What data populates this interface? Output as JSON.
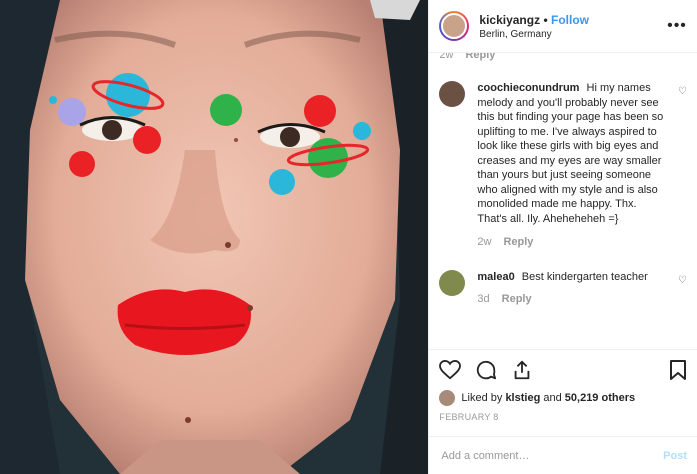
{
  "header": {
    "username": "kickiyangz",
    "separator": "•",
    "follow_label": "Follow",
    "location": "Berlin, Germany",
    "more_label": "•••"
  },
  "top_meta": {
    "time": "2w",
    "reply_label": "Reply"
  },
  "comments": [
    {
      "username": "coochieconundrum",
      "text": "Hi my names melody and you'll probably never see this but finding your page has been so uplifting to me. I've always aspired to look like these girls with big eyes and creases and my eyes are way smaller than yours but just seeing someone who aligned with my style and is also monolided made me happy. Thx. That's all. Ily. Aheheheheh =}",
      "time": "2w",
      "reply_label": "Reply"
    },
    {
      "username": "malea0",
      "text": "Best kindergarten teacher",
      "time": "3d",
      "reply_label": "Reply"
    }
  ],
  "likes": {
    "prefix": "Liked by ",
    "user": "klstieg",
    "joiner": " and ",
    "count": "50,219 others"
  },
  "date": "FEBRUARY 8",
  "add_comment": {
    "placeholder": "Add a comment…",
    "post_label": "Post"
  },
  "icons": {
    "like": "heart-icon",
    "comment": "comment-icon",
    "share": "share-icon",
    "save": "bookmark-icon"
  },
  "colors": {
    "accent": "#3897f0",
    "post_disabled": "#b2dffc",
    "muted": "#999999"
  }
}
